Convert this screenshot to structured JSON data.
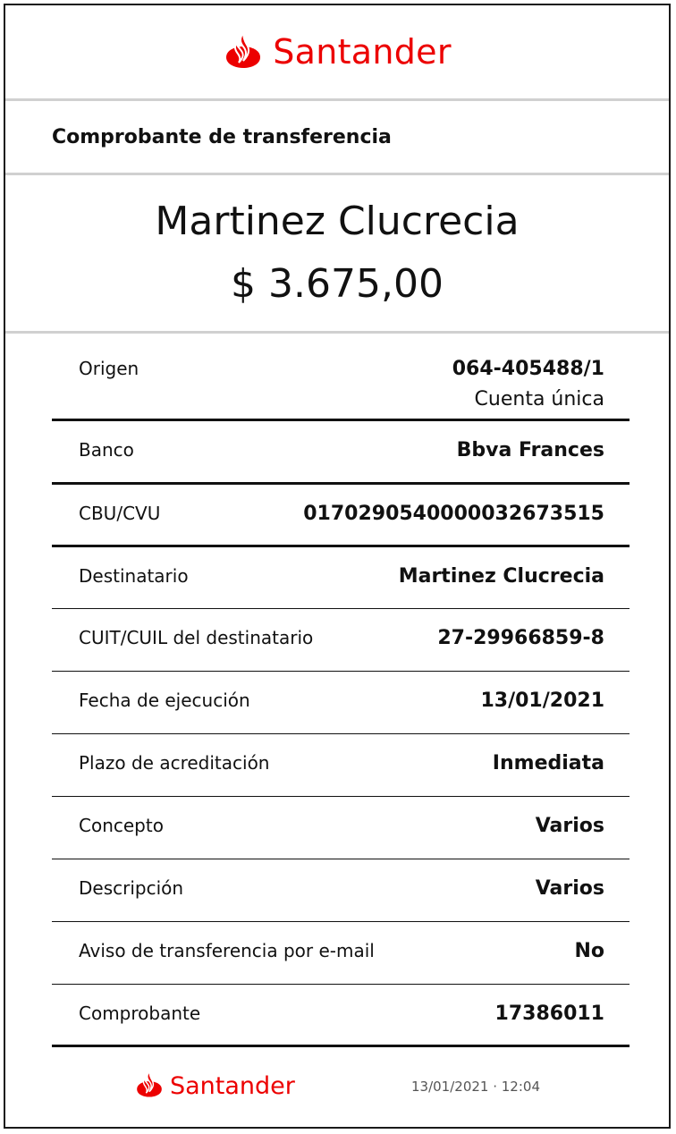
{
  "brand": {
    "name": "Santander",
    "color": "#ec0000"
  },
  "document": {
    "title": "Comprobante de transferencia"
  },
  "summary": {
    "recipient_name": "Martinez Clucrecia",
    "amount": "$ 3.675,00"
  },
  "details": [
    {
      "label": "Origen",
      "value": "064-405488/1",
      "subvalue": "Cuenta única"
    },
    {
      "label": "Banco",
      "value": "Bbva Frances"
    },
    {
      "label": "CBU/CVU",
      "value": "0170290540000032673515"
    },
    {
      "label": "Destinatario",
      "value": "Martinez Clucrecia"
    },
    {
      "label": "CUIT/CUIL del destinatario",
      "value": "27-29966859-8"
    },
    {
      "label": "Fecha de ejecución",
      "value": "13/01/2021"
    },
    {
      "label": "Plazo de acreditación",
      "value": "Inmediata"
    },
    {
      "label": "Concepto",
      "value": "Varios"
    },
    {
      "label": "Descripción",
      "value": "Varios"
    },
    {
      "label": "Aviso de transferencia por e-mail",
      "value": "No"
    },
    {
      "label": "Comprobante",
      "value": "17386011"
    }
  ],
  "footer": {
    "timestamp": "13/01/2021 · 12:04"
  },
  "icons": {
    "logo": "santander-flame-icon"
  }
}
